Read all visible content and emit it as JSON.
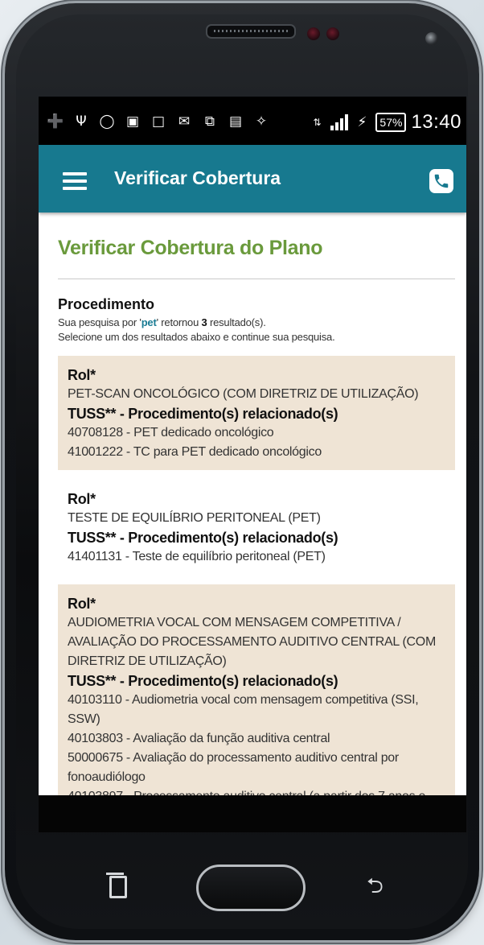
{
  "status_bar": {
    "icons": [
      "plus-square-icon",
      "usb-icon",
      "messenger-icon",
      "image-icon",
      "square-icon",
      "gmail-icon",
      "copy-icon",
      "media-icon",
      "lightbulb-icon"
    ],
    "battery": "57%",
    "time": "13:40"
  },
  "app_bar": {
    "title": "Verificar Cobertura",
    "menu_icon": "hamburger-menu-icon",
    "phone_icon": "phone-icon"
  },
  "page": {
    "title": "Verificar Cobertura do Plano",
    "section_label": "Procedimento",
    "search_prefix": "Sua pesquisa por '",
    "search_term": "pet",
    "search_mid": "' retornou ",
    "result_count": "3",
    "search_suffix": " resultado(s).",
    "instruction": "Selecione um dos resultados abaixo e continue sua pesquisa."
  },
  "results": [
    {
      "rol_label": "Rol*",
      "rol_text": "PET-SCAN ONCOLÓGICO (COM DIRETRIZ DE UTILIZAÇÃO)",
      "tuss_label": "TUSS** - Procedimento(s) relacionado(s)",
      "items": [
        "40708128 - PET dedicado oncológico",
        "41001222 - TC para PET dedicado oncológico"
      ]
    },
    {
      "rol_label": "Rol*",
      "rol_text": "TESTE DE EQUILÍBRIO PERITONEAL (PET)",
      "tuss_label": "TUSS** - Procedimento(s) relacionado(s)",
      "items": [
        "41401131 - Teste de equilíbrio peritoneal (PET)"
      ]
    },
    {
      "rol_label": "Rol*",
      "rol_text": "AUDIOMETRIA VOCAL COM MENSAGEM COMPETITIVA / AVALIAÇÃO DO PROCESSAMENTO AUDITIVO CENTRAL (COM DIRETRIZ DE UTILIZAÇÃO)",
      "tuss_label": "TUSS** - Procedimento(s) relacionado(s)",
      "items": [
        "40103110 - Audiometria vocal com mensagem competitiva (SSI, SSW)",
        "40103803 - Avaliação da função auditiva central",
        "50000675 - Avaliação do processamento auditivo central por fonoaudiólogo",
        "40103897 - Processamento auditivo central (a partir dos 7 anos e"
      ]
    }
  ]
}
